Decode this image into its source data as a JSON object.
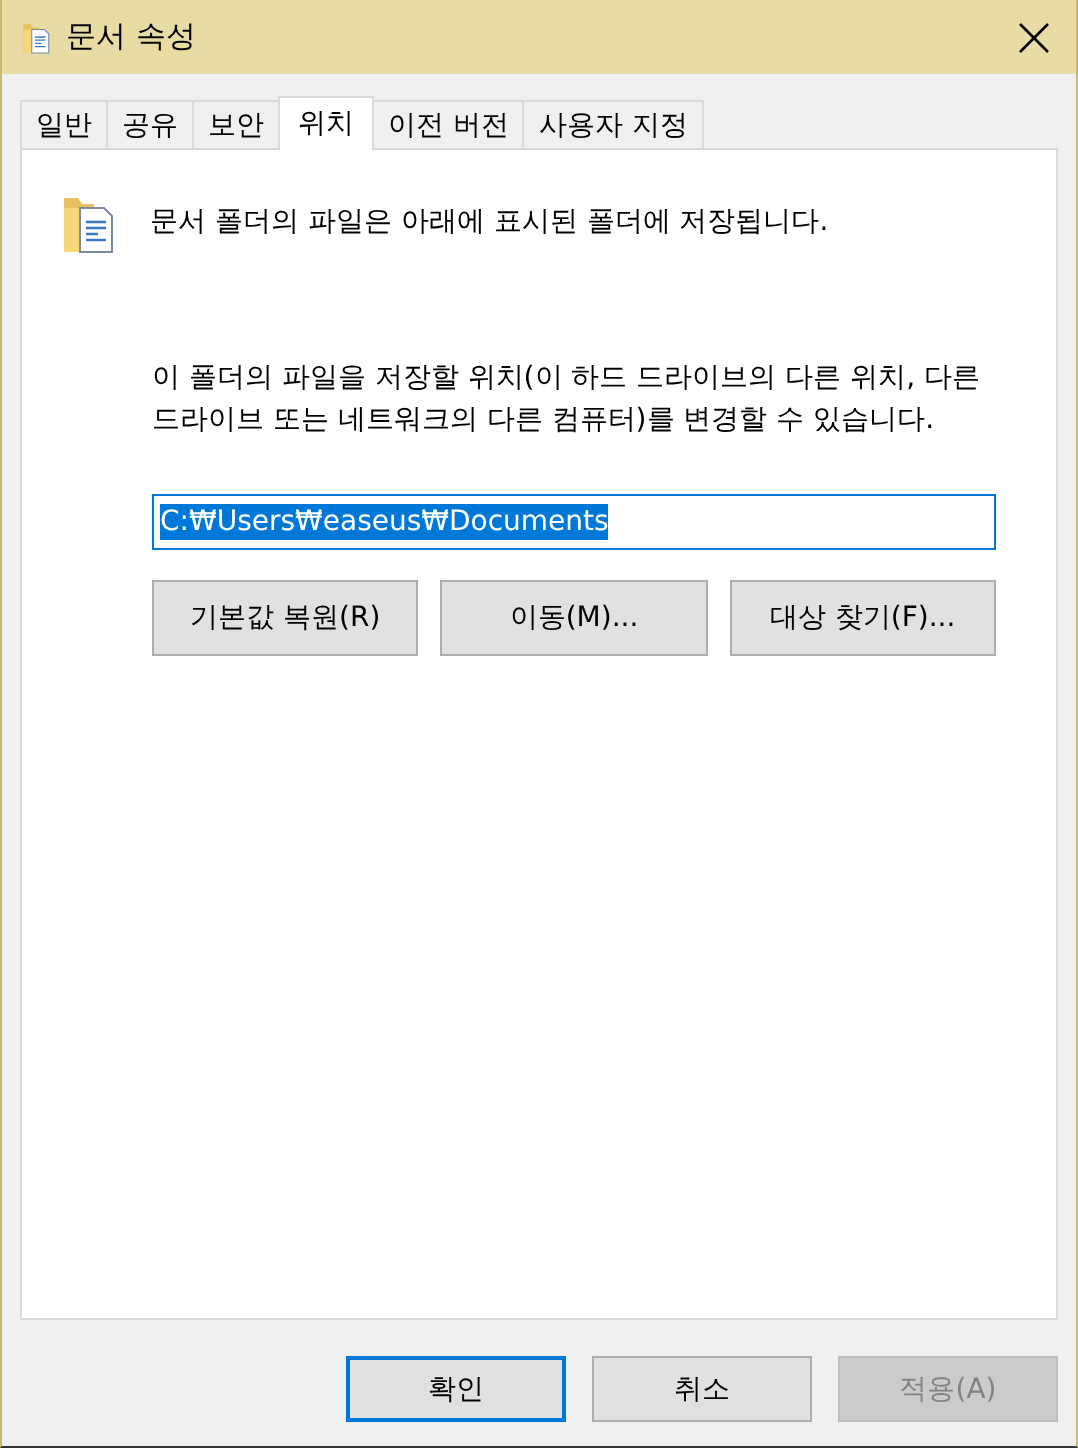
{
  "window": {
    "title": "문서 속성"
  },
  "tabs": [
    {
      "label": "일반",
      "selected": false
    },
    {
      "label": "공유",
      "selected": false
    },
    {
      "label": "보안",
      "selected": false
    },
    {
      "label": "위치",
      "selected": true
    },
    {
      "label": "이전 버전",
      "selected": false
    },
    {
      "label": "사용자 지정",
      "selected": false
    }
  ],
  "location": {
    "heading": "문서 폴더의 파일은 아래에 표시된 폴더에 저장됩니다.",
    "description": "이 폴더의 파일을 저장할 위치(이 하드 드라이브의 다른 위치, 다른 드라이브 또는 네트워크의 다른 컴퓨터)를 변경할 수 있습니다.",
    "path": {
      "value": "C:₩Users₩easeus₩Documents",
      "text_selected": true
    },
    "buttons": [
      {
        "label": "기본값 복원(R)"
      },
      {
        "label": "이동(M)..."
      },
      {
        "label": "대상 찾기(F)..."
      }
    ]
  },
  "footer_buttons": [
    {
      "label": "확인",
      "default": true,
      "disabled": false
    },
    {
      "label": "취소",
      "default": false,
      "disabled": false
    },
    {
      "label": "적용(A)",
      "default": false,
      "disabled": true
    }
  ]
}
